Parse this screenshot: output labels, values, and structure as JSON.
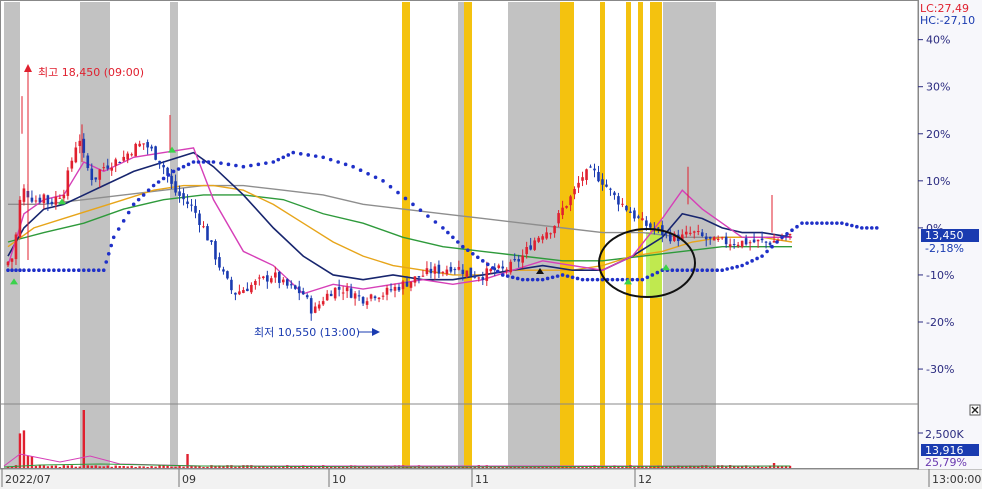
{
  "chart_data": {
    "type": "candlestick",
    "lc_label": "LC:27,49",
    "hc_label": "HC:-27,10",
    "y_axis_ticks": [
      "40%",
      "30%",
      "20%",
      "10%",
      "0%",
      "-10%",
      "-20%",
      "-30%"
    ],
    "y_axis_ticks_values": [
      40,
      30,
      20,
      10,
      0,
      -10,
      -20,
      -30
    ],
    "ylim": [
      -37,
      48
    ],
    "current_price_label": "13,450",
    "current_change_label": "-2,18%",
    "current_change_value": -2.18,
    "volume_tick_label": "2,500K",
    "volume_badge": "13,916",
    "volume_pct_label": "25,79%",
    "x_labels": [
      "2022/07",
      "09",
      "10",
      "11",
      "12",
      "13:00:00"
    ],
    "high_annotation": "최고 18,450 (09:00)",
    "low_annotation": "최저 10,550 (13:00)",
    "close_icon": "close-icon",
    "colors": {
      "up": "#e0202f",
      "down": "#1a3bb0",
      "ma5": "#d63fb8",
      "ma20": "#17256e",
      "ma60": "#e7a51a",
      "ma120": "#2e9a3b",
      "ma240": "#8e8e8e",
      "dots": "#1f30c8",
      "shade_gray": "#c2c2c2",
      "shade_yellow": "#f4c20f",
      "shade_green": "#b6f05a",
      "axis": "#2b2b80"
    },
    "price_series": {
      "x": [
        0,
        5,
        10,
        15,
        20,
        25,
        30,
        35,
        40,
        45,
        50,
        55,
        60,
        65,
        70,
        75,
        80,
        85,
        90,
        95,
        100,
        110,
        120,
        130,
        140,
        150,
        160,
        170,
        180,
        190,
        200,
        210,
        220,
        230,
        240,
        250,
        260,
        270,
        280,
        290,
        300,
        310,
        320,
        330,
        340,
        350,
        360,
        370,
        380,
        390,
        400,
        410,
        420,
        430,
        440,
        450,
        460,
        470,
        480,
        490,
        500,
        510,
        520,
        530,
        540,
        550,
        560,
        570,
        580,
        590,
        600,
        610,
        620,
        630,
        640,
        650,
        660,
        670,
        680,
        690,
        700,
        710,
        720,
        730,
        740,
        750,
        760,
        770,
        780,
        790
      ],
      "y": [
        -8,
        -7,
        -6,
        5,
        8,
        7,
        6,
        6,
        7,
        5,
        6,
        7,
        8,
        12,
        16,
        20,
        15,
        12,
        10,
        12,
        13,
        14,
        15,
        17,
        18,
        16,
        13,
        8,
        6,
        4,
        0,
        -5,
        -10,
        -14,
        -13,
        -12,
        -11,
        -10,
        -12,
        -13,
        -14,
        -18,
        -15,
        -13,
        -13,
        -14,
        -15,
        -14,
        -14,
        -13,
        -12,
        -11,
        -10,
        -9,
        -9,
        -8,
        -9,
        -10,
        -10,
        -9,
        -9,
        -8,
        -6,
        -3,
        -1,
        0,
        4,
        7,
        11,
        12,
        10,
        7,
        5,
        3,
        1,
        0,
        -1,
        -2,
        -2,
        -1,
        -2,
        -3,
        -3,
        -3,
        -3,
        -3,
        -3,
        -3,
        -2,
        -2
      ]
    },
    "series_names": []
  }
}
